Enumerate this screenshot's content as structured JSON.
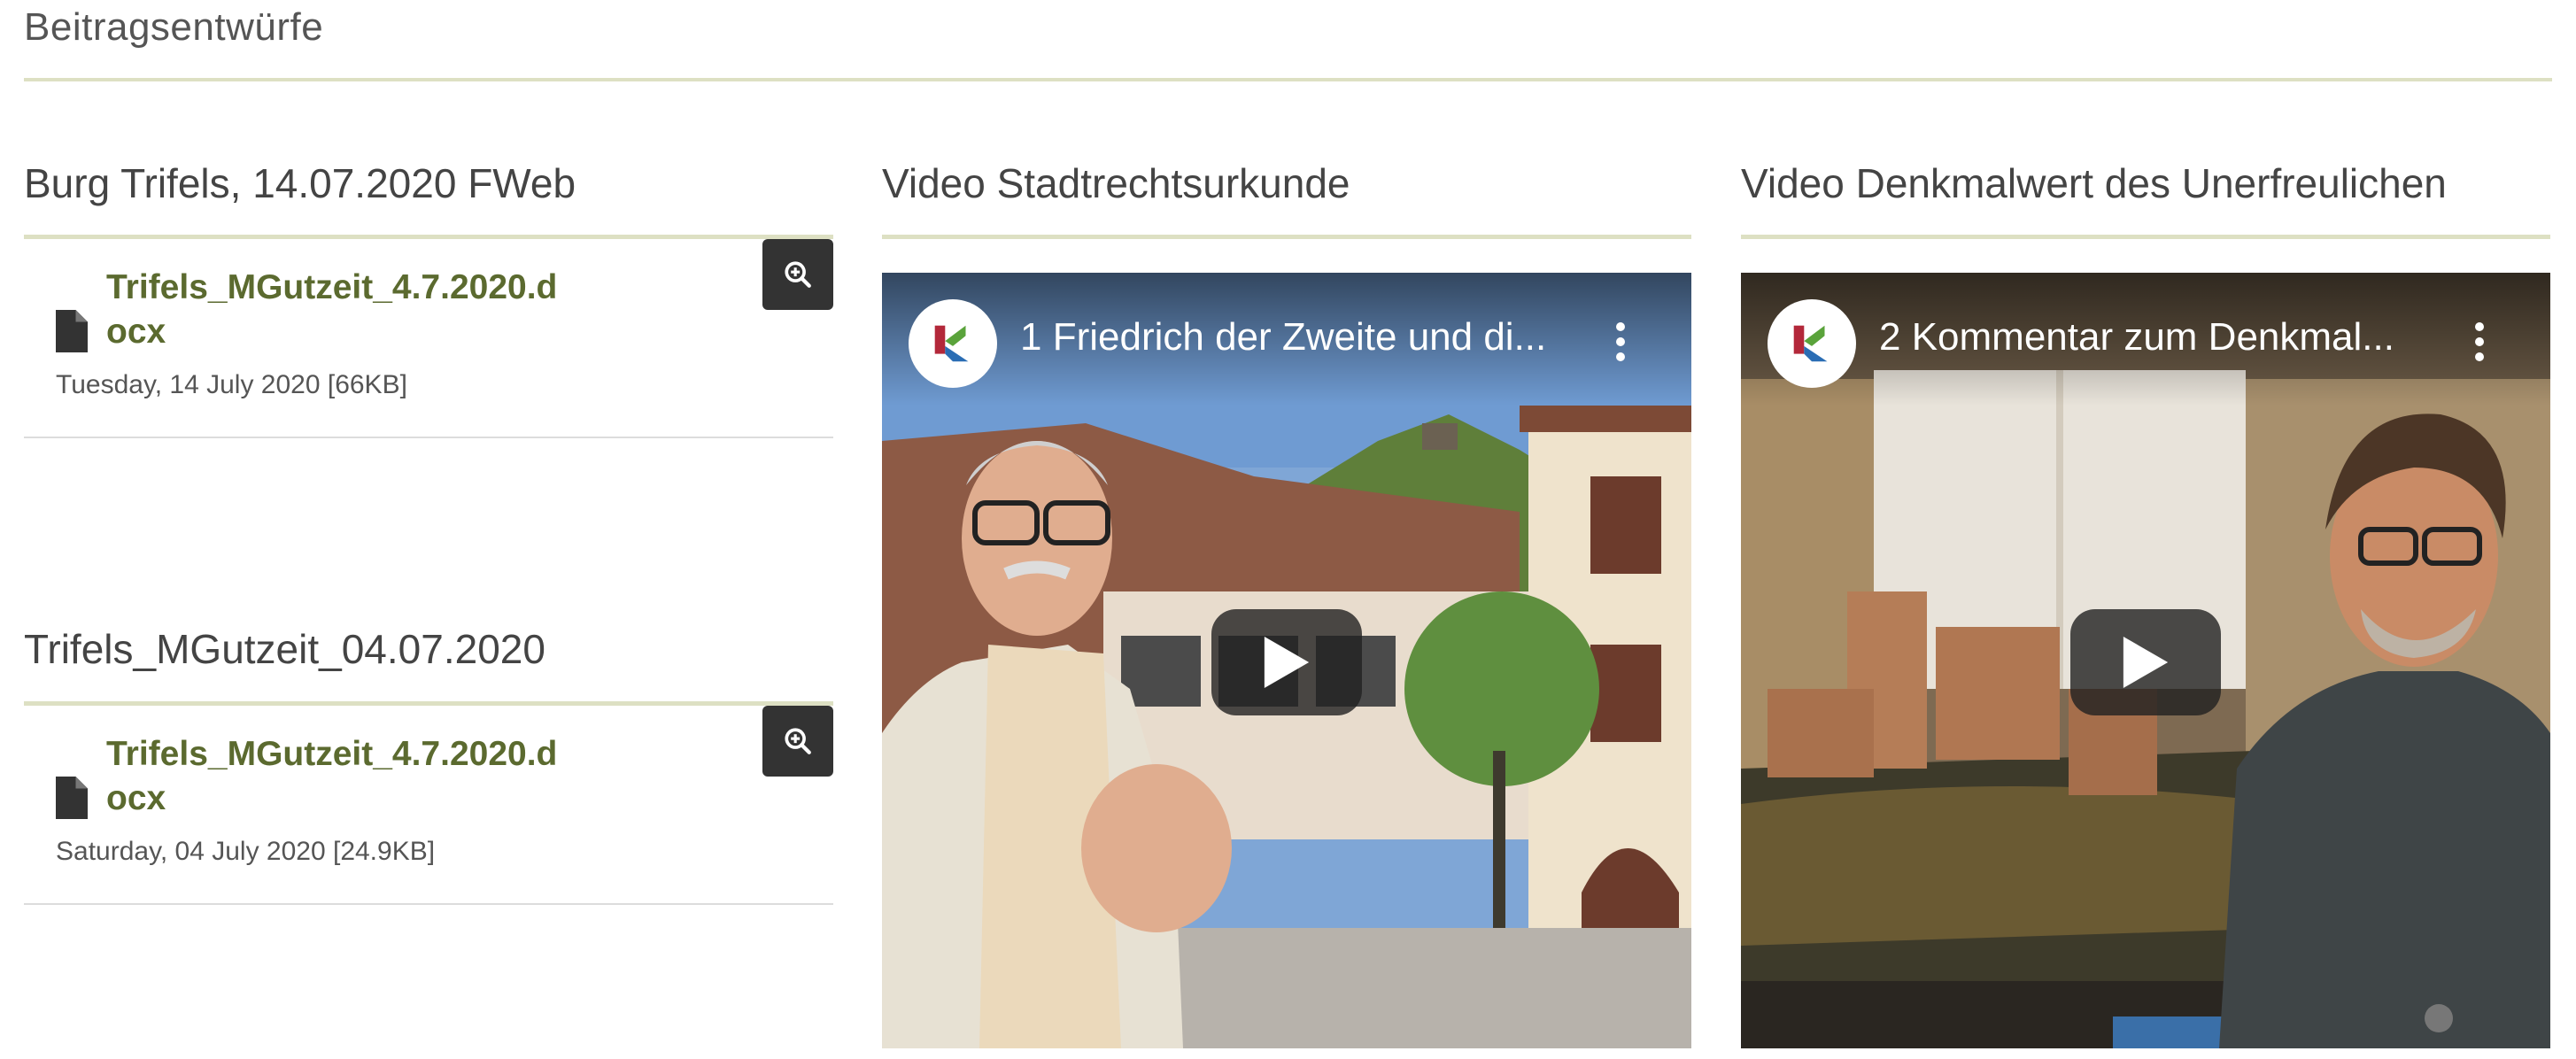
{
  "section": {
    "title": "Beitragsentwürfe"
  },
  "columns": [
    {
      "title": "Burg Trifels, 14.07.2020 FWeb",
      "file": {
        "name": "Trifels_MGutzeit_4.7.2020.docx",
        "meta": "Tuesday, 14 July 2020 [66KB]",
        "icon": "document-icon"
      }
    },
    {
      "title": "Video Stadtrechtsurkunde"
    },
    {
      "title": "Video Denkmalwert des Unerfreulichen"
    },
    {
      "title": "Trifels_MGutzeit_04.07.2020",
      "file": {
        "name": "Trifels_MGutzeit_4.7.2020.docx",
        "meta": "Saturday, 04 July 2020 [24.9KB]",
        "icon": "document-icon"
      }
    }
  ],
  "videos": [
    {
      "title": "1 Friedrich der Zweite und di...",
      "channel_logo": "channel-logo-icon",
      "menu_icon": "more-vert-icon",
      "play_icon": "play-icon"
    },
    {
      "title": "2 Kommentar zum Denkmal...",
      "channel_logo": "channel-logo-icon",
      "menu_icon": "more-vert-icon",
      "play_icon": "play-icon"
    }
  ],
  "colors": {
    "accent_rule": "#dde0c3",
    "link": "#5b6a2f",
    "button_dark": "#333333"
  }
}
